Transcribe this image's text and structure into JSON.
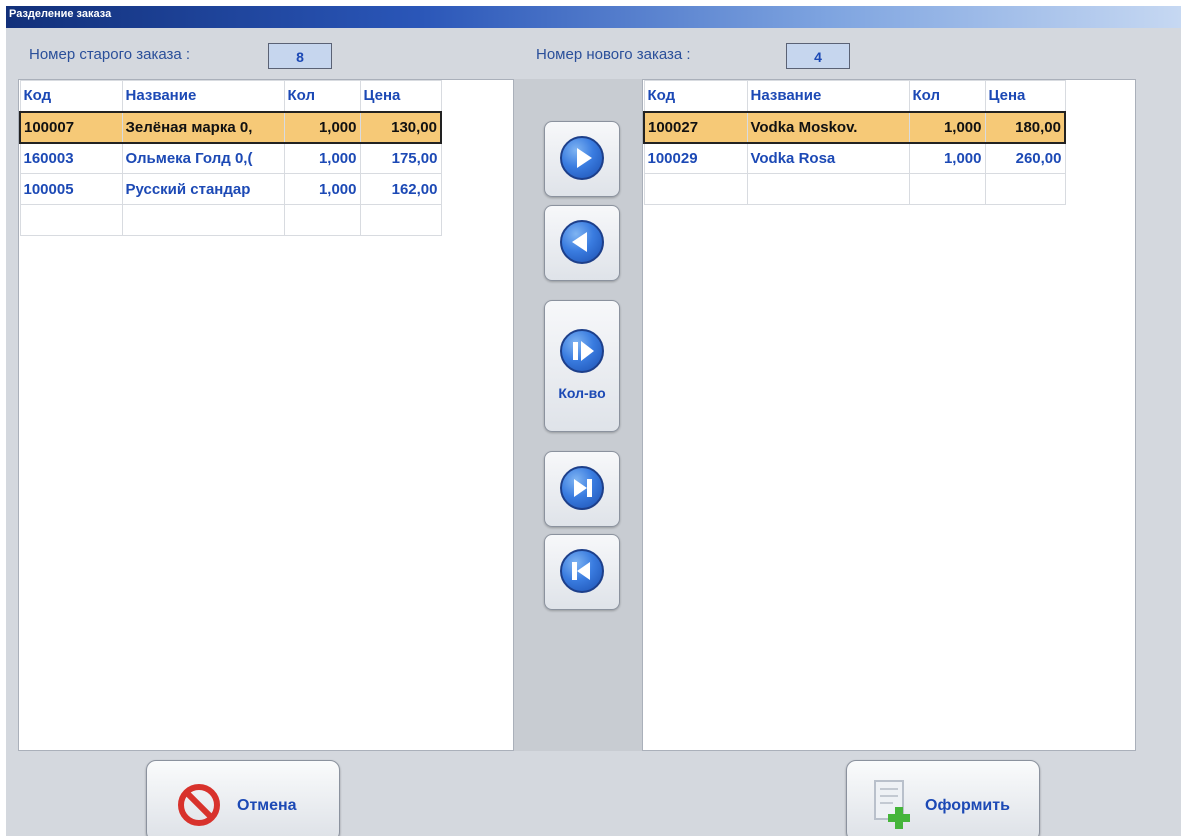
{
  "window": {
    "title": "Разделение заказа"
  },
  "old_order": {
    "label": "Номер старого заказа :",
    "number": "8"
  },
  "new_order": {
    "label": "Номер нового заказа :",
    "number": "4"
  },
  "columns": [
    "Код",
    "Название",
    "Кол",
    "Цена"
  ],
  "left_table": {
    "rows": [
      {
        "code": "100007",
        "name": "Зелёная марка 0,",
        "qty": "1,000",
        "price": "130,00",
        "selected": true
      },
      {
        "code": "160003",
        "name": "Ольмека Голд 0,(",
        "qty": "1,000",
        "price": "175,00",
        "selected": false
      },
      {
        "code": "100005",
        "name": "Русский стандар",
        "qty": "1,000",
        "price": "162,00",
        "selected": false
      }
    ]
  },
  "right_table": {
    "rows": [
      {
        "code": "100027",
        "name": "Vodka Moskov.",
        "qty": "1,000",
        "price": "180,00",
        "selected": true
      },
      {
        "code": "100029",
        "name": "Vodka Rosa",
        "qty": "1,000",
        "price": "260,00",
        "selected": false
      }
    ]
  },
  "move_buttons": {
    "move_right_icon": "play-right-icon",
    "move_left_icon": "play-left-icon",
    "move_quantity_icon": "pause-play-icon",
    "move_quantity_label": "Кол-во",
    "move_all_right_icon": "skip-forward-icon",
    "move_all_left_icon": "skip-back-icon"
  },
  "footer": {
    "cancel_label": "Отмена",
    "cancel_icon": "no-entry-icon",
    "submit_label": "Оформить",
    "submit_icon": "document-add-icon"
  },
  "colors": {
    "accent_text": "#1c49b5",
    "selected_row": "#f6c977",
    "titlebar": "#12307a"
  }
}
